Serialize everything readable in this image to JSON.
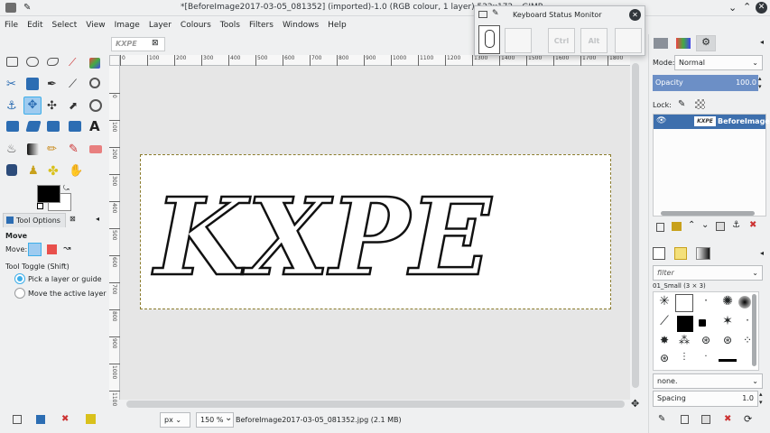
{
  "window": {
    "title": "*[BeforeImage2017-03-05_081352] (imported)-1.0 (RGB colour, 1 layer) 522x172 – GIMP"
  },
  "menu": [
    "File",
    "Edit",
    "Select",
    "View",
    "Image",
    "Layer",
    "Colours",
    "Tools",
    "Filters",
    "Windows",
    "Help"
  ],
  "image_tab": {
    "thumb_text": "KXPE"
  },
  "canvas": {
    "text": "KXPE"
  },
  "ruler_top": [
    "0",
    "100",
    "200",
    "300",
    "400",
    "500",
    "600",
    "700",
    "800",
    "900",
    "1000",
    "1100",
    "1200",
    "1300",
    "1400",
    "1500",
    "1600",
    "1700",
    "1800",
    "1900"
  ],
  "ruler_left": [
    "0",
    "100",
    "200",
    "300",
    "400",
    "500",
    "600",
    "700",
    "800",
    "900",
    "1000",
    "1100",
    "1200",
    "1300",
    "1400"
  ],
  "tool_options": {
    "tab_label": "Tool Options",
    "tool_name": "Move",
    "move_label": "Move:",
    "toggle_label": "Tool Toggle (Shift)",
    "radio1": "Pick a layer or guide",
    "radio2": "Move the active layer"
  },
  "status": {
    "unit": "px",
    "zoom": "150 %",
    "file": "BeforeImage2017-03-05_081352.jpg (2.1 MB)"
  },
  "layers": {
    "mode_label": "Mode:",
    "mode_value": "Normal",
    "opacity_label": "Opacity",
    "opacity_value": "100.0",
    "lock_label": "Lock:",
    "layer_name": "BeforeImage2",
    "layer_thumb": "KXPE"
  },
  "brushes": {
    "filter_placeholder": "filter",
    "brush_name": "01_Small (3 × 3)",
    "tag_value": "none.",
    "spacing_label": "Spacing",
    "spacing_value": "1.0"
  },
  "keyboard_monitor": {
    "title": "Keyboard Status Monitor",
    "keys": [
      "Ctrl",
      "Alt"
    ]
  },
  "colors": {
    "accent": "#3daee9",
    "selected_row": "#3d6fad",
    "opacity_bar": "#6c8fc6"
  }
}
